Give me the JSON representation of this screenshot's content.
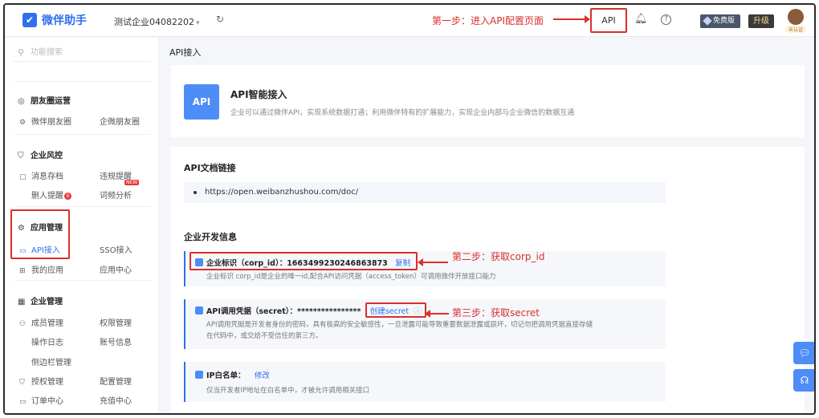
{
  "topbar": {
    "brand": "微伴助手",
    "company": "测试企业04082202",
    "api_button": "API",
    "free_badge": "免费版",
    "upgrade": "升级",
    "avatar_tag": "未认证"
  },
  "annotations": {
    "step1": "第一步：进入API配置页面",
    "step2": "第二步：获取corp_id",
    "step3": "第三步：获取secret"
  },
  "sidebar": {
    "search_placeholder": "功能搜索",
    "moments": {
      "title": "朋友圈运营",
      "items": [
        "微伴朋友圈",
        "企微朋友圈"
      ]
    },
    "risk": {
      "title": "企业风控",
      "items": [
        "消息存档",
        "违规提醒",
        "删人提醒",
        "词频分析"
      ],
      "badge": "6",
      "new_tag": "NEW"
    },
    "apps": {
      "title": "应用管理",
      "items": [
        "API接入",
        "SSO接入",
        "我的应用",
        "应用中心"
      ]
    },
    "enterprise": {
      "title": "企业管理",
      "items": [
        "成员管理",
        "权限管理",
        "操作日志",
        "账号信息",
        "侧边栏管理",
        "授权管理",
        "配置管理",
        "订单中心",
        "充值中心"
      ]
    }
  },
  "main": {
    "page_title": "API接入",
    "intro": {
      "logo": "API",
      "title": "API智能接入",
      "desc": "企业可以通过微伴API，实现系统数据打通；利用微伴特有的扩展能力，实现企业内部与企业微信的数据互通"
    },
    "docs": {
      "title": "API文档链接",
      "url": "https://open.weibanzhushou.com/doc/"
    },
    "dev": {
      "title": "企业开发信息",
      "corp_label": "企业标识（corp_id）：1663499230246863873",
      "copy": "复制",
      "corp_desc": "企业标识 corp_id是企业的唯一id,配合API访问凭据（access_token）可调用微伴开放接口能力",
      "secret_label": "API调用凭据（secret）：****************",
      "create_secret": "创建secret",
      "secret_desc_1": "API调用凭据是开发者身份的密码，具有极高的安全敏感性，一旦泄露可能导致重要数据泄露或损坏，切记勿把调用凭据直接存储",
      "secret_desc_2": "在代码中，或交给不受信任的第三方。",
      "whitelist_label": "IP白名单：",
      "modify": "修改",
      "whitelist_desc": "仅当开发者IP地址在白名单中，才被允许调用相关接口"
    }
  }
}
